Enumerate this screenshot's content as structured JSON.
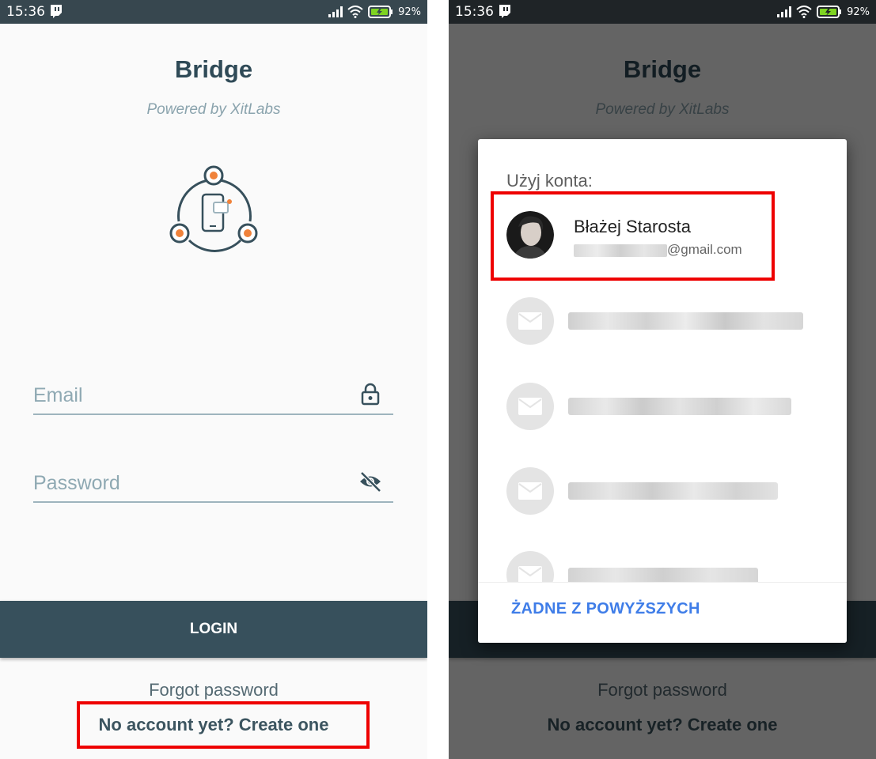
{
  "status": {
    "time": "15:36",
    "battery": "92%"
  },
  "app": {
    "title": "Bridge",
    "subtitle": "Powered by XitLabs",
    "email_label": "Email",
    "password_label": "Password",
    "login_label": "LOGIN",
    "forgot_label": "Forgot password",
    "create_label": "No account yet? Create one"
  },
  "dialog": {
    "title": "Użyj konta:",
    "primary_account": {
      "name": "Błażej Starosta",
      "email_suffix": "@gmail.com"
    },
    "none_label": "ŻADNE Z POWYŻSZYCH"
  },
  "colors": {
    "accent": "#37505c",
    "link": "#3f7de8",
    "highlight": "#ee0000"
  }
}
